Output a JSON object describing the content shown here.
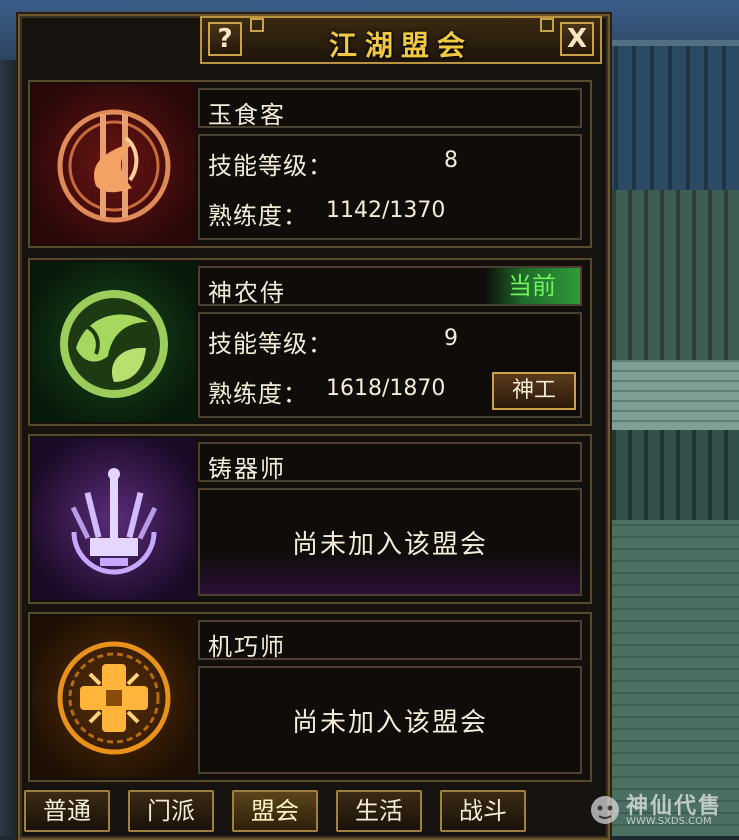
{
  "window": {
    "title": "江湖盟会",
    "help_label": "?",
    "close_label": "X"
  },
  "guilds": [
    {
      "name": "玉食客",
      "emblem": "chef-emblem-icon",
      "color": "#b8552a",
      "skill_level_label": "技能等级：",
      "skill_level": "8",
      "proficiency_label": "熟练度：",
      "proficiency": "1142/1370"
    },
    {
      "name": "神农侍",
      "emblem": "herbalist-emblem-icon",
      "color": "#6fae3a",
      "current_badge": "当前",
      "skill_level_label": "技能等级：",
      "skill_level": "9",
      "proficiency_label": "熟练度：",
      "proficiency": "1618/1870",
      "action_button": "神工"
    },
    {
      "name": "铸器师",
      "emblem": "forge-emblem-icon",
      "color": "#9a7ad8",
      "status": "尚未加入该盟会"
    },
    {
      "name": "机巧师",
      "emblem": "artisan-emblem-icon",
      "color": "#e0901a",
      "status": "尚未加入该盟会"
    }
  ],
  "tabs": [
    {
      "label": "普通",
      "active": false
    },
    {
      "label": "门派",
      "active": false
    },
    {
      "label": "盟会",
      "active": true
    },
    {
      "label": "生活",
      "active": false
    },
    {
      "label": "战斗",
      "active": false
    }
  ],
  "watermark": {
    "text": "神仙代售",
    "url": "WWW.SXDS.COM"
  }
}
